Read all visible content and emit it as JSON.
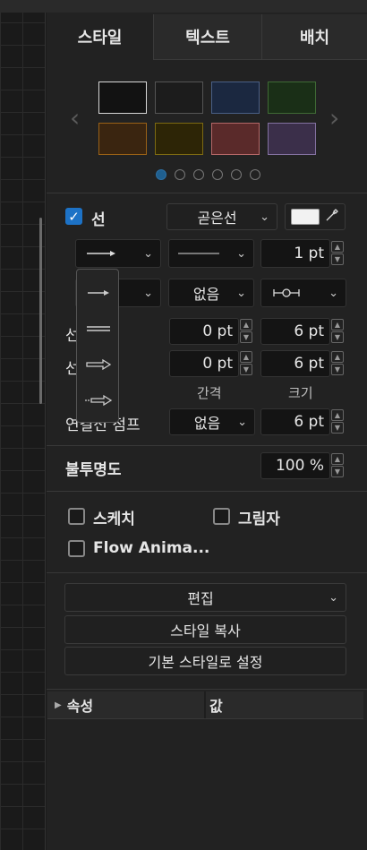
{
  "tabs": [
    "스타일",
    "텍스트",
    "배치"
  ],
  "swatches": [
    {
      "fill": "#121212",
      "border": "#d8d8d8"
    },
    {
      "fill": "#1c1c1c",
      "border": "#555555"
    },
    {
      "fill": "#1b2840",
      "border": "#4a5f86"
    },
    {
      "fill": "#1a2f17",
      "border": "#3f6a35"
    },
    {
      "fill": "#3a2510",
      "border": "#9a6116"
    },
    {
      "fill": "#2d2506",
      "border": "#7d6a12"
    },
    {
      "fill": "#5a2a2a",
      "border": "#b46767"
    },
    {
      "fill": "#3b2f4a",
      "border": "#8371a0"
    }
  ],
  "pager": {
    "count": 6,
    "active": 0
  },
  "line": {
    "label": "선",
    "checked": true,
    "type": "곧은선",
    "color": "#f2f2f2",
    "width": "1 pt",
    "end_none": "없음",
    "spacing1": "0 pt",
    "size1": "6 pt",
    "spacing2": "0 pt",
    "size2": "6 pt",
    "spacing_label": "간격",
    "size_label": "크기",
    "row1_label": "선",
    "row2_label": "선",
    "jump_label": "연결선 점프",
    "jump_value": "없음",
    "jump_size": "6 pt"
  },
  "opacity": {
    "label": "불투명도",
    "value": "100 %"
  },
  "options": {
    "sketch": "스케치",
    "shadow": "그림자",
    "flow": "Flow Anima..."
  },
  "buttons": {
    "edit": "편집",
    "copy_style": "스타일 복사",
    "set_default": "기본 스타일로 설정"
  },
  "table": {
    "col1": "속성",
    "col2": "값"
  },
  "icons": [
    "chevron-left-icon",
    "chevron-right-icon",
    "eyedropper-icon",
    "waypoint-icon",
    "arrow-end-icon",
    "chevron-down-icon"
  ]
}
